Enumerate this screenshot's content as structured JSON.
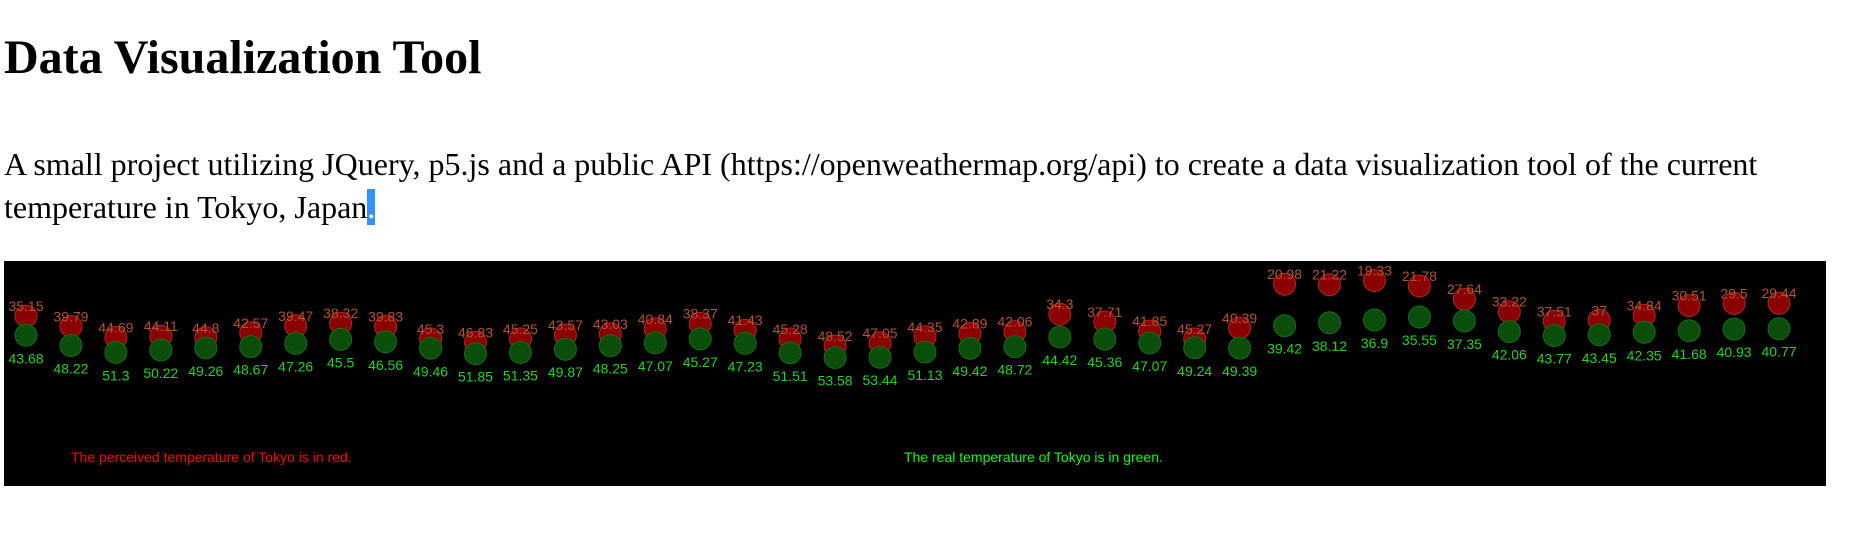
{
  "page": {
    "title": "Data Visualization Tool",
    "description": "A small project utilizing JQuery, p5.js and a public API (https://openweathermap.org/api) to create a data visualization tool of the current temperature in Tokyo, Japan",
    "selected_text": "."
  },
  "colors": {
    "canvas_background": "#000000",
    "perceived": "#ff0000",
    "real": "#00ff00",
    "perceived_circle": "#8b0000",
    "real_circle": "#0b4d0b",
    "label_perceived": "#b5542a",
    "label_real": "#22d322"
  },
  "chart_data": {
    "type": "scatter",
    "title": "",
    "xlabel": "",
    "ylabel": "",
    "grid": false,
    "series": [
      {
        "name": "perceived",
        "values": [
          35.15,
          39.79,
          44.69,
          44.11,
          44.8,
          42.57,
          39.47,
          38.32,
          39.83,
          45.3,
          46.83,
          45.25,
          43.57,
          43.03,
          40.84,
          38.37,
          41.43,
          45.28,
          48.52,
          47.05,
          44.35,
          42.89,
          42.06,
          34.3,
          37.71,
          41.85,
          45.27,
          40.39,
          20.98,
          21.22,
          19.33,
          21.78,
          27.64,
          33.22,
          37.51,
          37,
          34.84,
          30.51,
          29.5,
          29.44
        ]
      },
      {
        "name": "real",
        "values": [
          43.68,
          48.22,
          51.3,
          50.22,
          49.26,
          48.67,
          47.26,
          45.5,
          46.56,
          49.46,
          51.85,
          51.35,
          49.87,
          48.25,
          47.07,
          45.27,
          47.23,
          51.51,
          53.58,
          53.44,
          51.13,
          49.42,
          48.72,
          44.42,
          45.36,
          47.07,
          49.24,
          49.39,
          39.42,
          38.12,
          36.9,
          35.55,
          37.35,
          42.06,
          43.77,
          43.45,
          42.35,
          41.68,
          40.93,
          40.77
        ]
      }
    ],
    "legend": {
      "perceived_note": "The perceived temperature of Tokyo is in red.",
      "real_note": "The real temperature of Tokyo is in green."
    }
  }
}
